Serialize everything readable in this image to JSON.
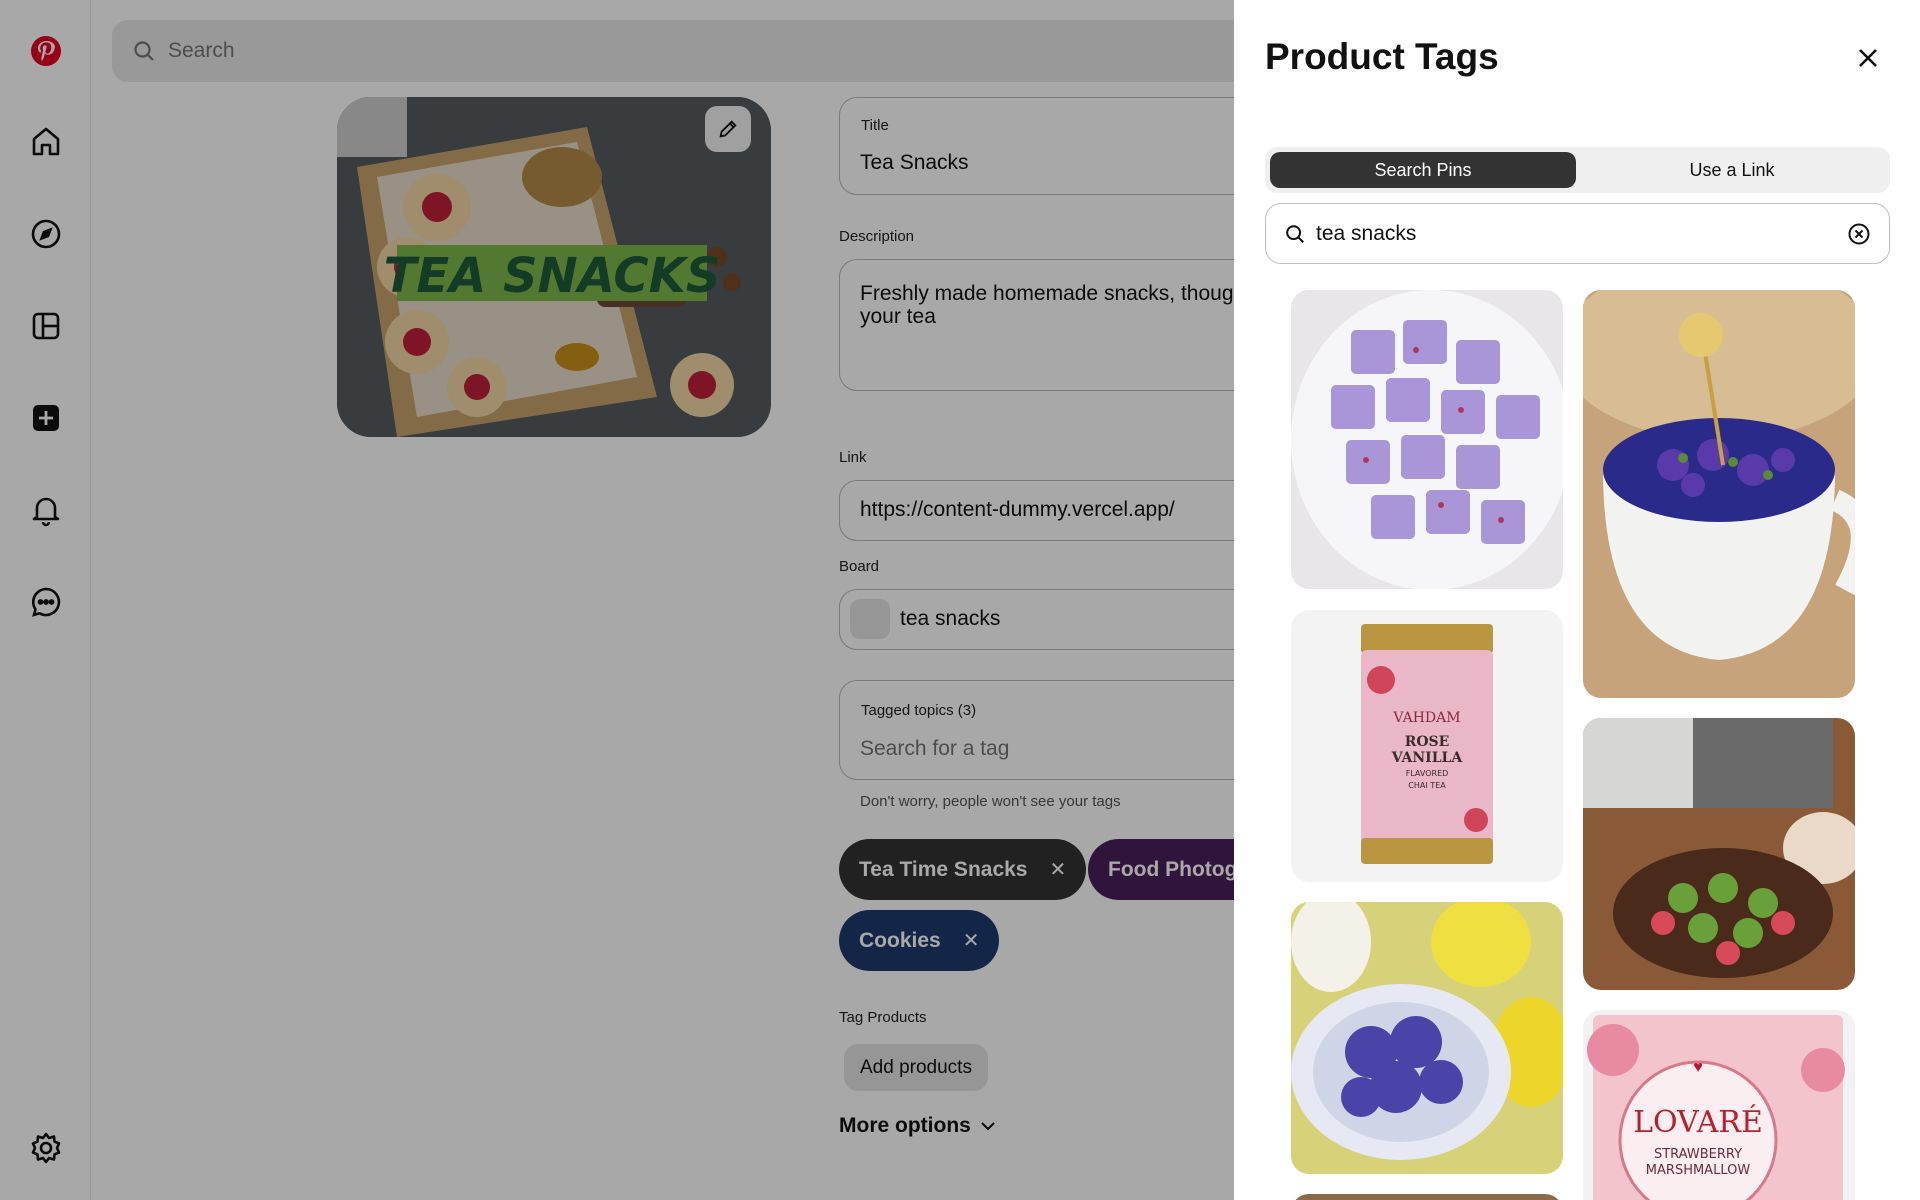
{
  "top_search": {
    "placeholder": "Search"
  },
  "pin_editor": {
    "image_text": "TEA SNACKS",
    "title_label": "Title",
    "title_value": "Tea Snacks",
    "description_label": "Description",
    "description_value": "Freshly made homemade snacks, thoug",
    "description_line2": "your tea",
    "link_label": "Link",
    "link_value": "https://content-dummy.vercel.app/",
    "board_label": "Board",
    "board_value": "tea snacks",
    "tagged_label": "Tagged topics (3)",
    "tag_placeholder": "Search for a tag",
    "tag_hint": "Don't worry, people won't see your tags",
    "tags": [
      {
        "label": "Tea Time Snacks",
        "color": "#333333"
      },
      {
        "label": "Food Photogr",
        "color": "#4a1f5a"
      },
      {
        "label": "Cookies",
        "color": "#1f3a6e"
      }
    ],
    "tag_products_label": "Tag Products",
    "add_products_label": "Add products",
    "more_options_label": "More options"
  },
  "panel": {
    "title": "Product Tags",
    "tabs": [
      {
        "label": "Search Pins",
        "active": true
      },
      {
        "label": "Use a Link",
        "active": false
      }
    ],
    "search_value": "tea snacks",
    "results": [
      {
        "name": "purple-marshmallow-cubes"
      },
      {
        "name": "blue-flower-tea-cup"
      },
      {
        "name": "vahdam-tin"
      },
      {
        "name": "matcha-strawberry-chocolates"
      },
      {
        "name": "purple-heart-candies"
      },
      {
        "name": "lovare-tea-box"
      }
    ],
    "vahdam": {
      "brand": "VAHDAM",
      "line1": "ROSE",
      "line2": "VANILLA",
      "line3": "FLAVORED",
      "line4": "CHAI TEA"
    },
    "lovare": {
      "brand": "LOVARÉ",
      "line1": "STRAWBERRY",
      "line2": "MARSHMALLOW"
    }
  },
  "colors": {
    "brand": "#e60023",
    "accent_dark": "#333333",
    "overlay": "rgba(0,0,0,0.34)"
  },
  "icons": [
    "pinterest-logo-icon",
    "home-icon",
    "explore-icon",
    "dashboard-icon",
    "create-icon",
    "notifications-icon",
    "messages-icon",
    "settings-icon"
  ]
}
